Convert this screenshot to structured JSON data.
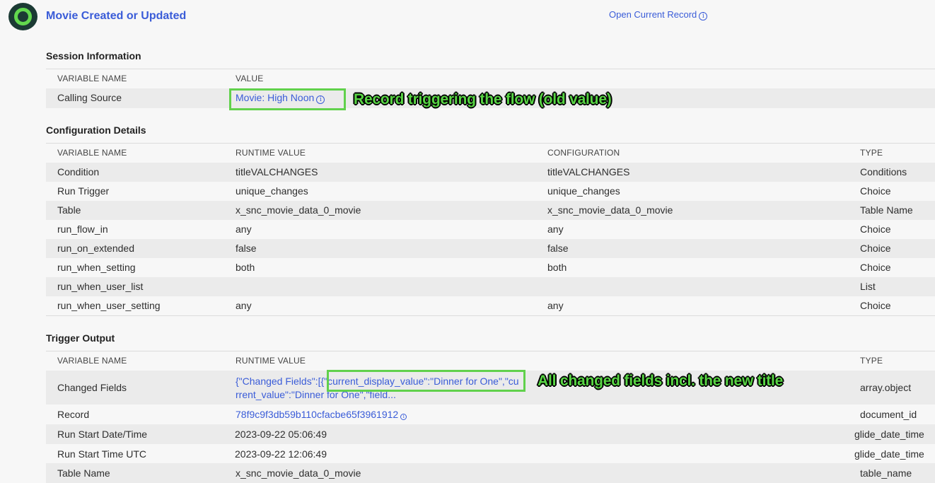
{
  "header": {
    "title": "Movie Created or Updated",
    "open_record": "Open Current Record",
    "info_glyph": "i"
  },
  "session": {
    "title": "Session Information",
    "col_name": "VARIABLE NAME",
    "col_value": "VALUE",
    "rows": [
      {
        "name": "Calling Source",
        "value": "Movie: High Noon"
      }
    ]
  },
  "config": {
    "title": "Configuration Details",
    "col_name": "VARIABLE NAME",
    "col_runtime": "RUNTIME VALUE",
    "col_config": "CONFIGURATION",
    "col_type": "TYPE",
    "rows": [
      {
        "name": "Condition",
        "runtime": "titleVALCHANGES",
        "config": "titleVALCHANGES",
        "type": "Conditions"
      },
      {
        "name": "Run Trigger",
        "runtime": "unique_changes",
        "config": "unique_changes",
        "type": "Choice"
      },
      {
        "name": "Table",
        "runtime": "x_snc_movie_data_0_movie",
        "config": "x_snc_movie_data_0_movie",
        "type": "Table Name"
      },
      {
        "name": "run_flow_in",
        "runtime": "any",
        "config": "any",
        "type": "Choice"
      },
      {
        "name": "run_on_extended",
        "runtime": "false",
        "config": "false",
        "type": "Choice"
      },
      {
        "name": "run_when_setting",
        "runtime": "both",
        "config": "both",
        "type": "Choice"
      },
      {
        "name": "run_when_user_list",
        "runtime": "",
        "config": "",
        "type": "List"
      },
      {
        "name": "run_when_user_setting",
        "runtime": "any",
        "config": "any",
        "type": "Choice"
      }
    ]
  },
  "trigger": {
    "title": "Trigger Output",
    "col_name": "VARIABLE NAME",
    "col_runtime": "RUNTIME VALUE",
    "col_type": "TYPE",
    "changed_fields": {
      "name": "Changed Fields",
      "line1a": "{\"Changed Fields\":[{",
      "line1b": "\"current_display_value\":\"Dinner for One\",",
      "line1c": "\"cu",
      "line2": "rrent_value\":\"Dinner for One\",\"field...",
      "type": "array.object"
    },
    "rows": [
      {
        "name": "Record",
        "runtime": "78f9c9f3db59b110cfacbe65f3961912",
        "type": "document_id"
      },
      {
        "name": "Run Start Date/Time",
        "runtime": "2023-09-22 05:06:49",
        "type": "glide_date_time"
      },
      {
        "name": "Run Start Time UTC",
        "runtime": "2023-09-22 12:06:49",
        "type": "glide_date_time"
      },
      {
        "name": "Table Name",
        "runtime": "x_snc_movie_data_0_movie",
        "type": "table_name"
      }
    ]
  },
  "annotations": {
    "calling_source": "Record triggering the flow (old value)",
    "changed_fields": "All changed fields incl. the new title"
  },
  "colors": {
    "link": "#3a5cd8",
    "highlight": "#61d14c",
    "logo_bg": "#1b3a34"
  }
}
